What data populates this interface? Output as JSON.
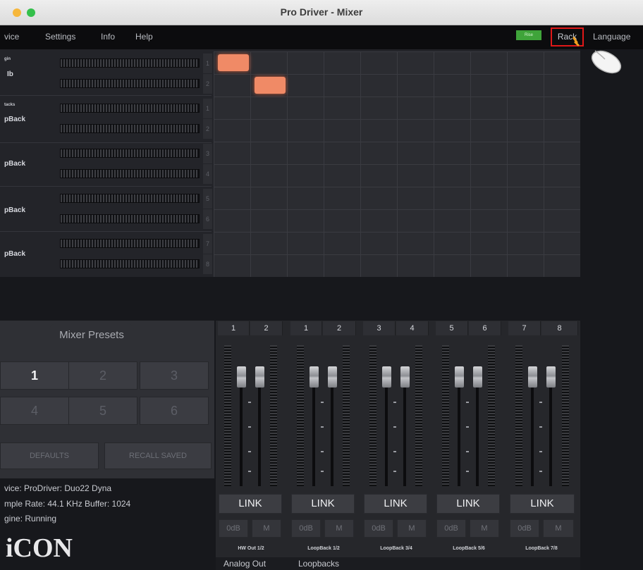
{
  "window": {
    "title": "Pro Driver - Mixer"
  },
  "menu": {
    "items": [
      "vice",
      "Settings",
      "Info",
      "Help"
    ],
    "rise_label": "Rise",
    "rack_label": "Rack",
    "language_label": "Language"
  },
  "routing": {
    "source_labels": {
      "g1_small": "gin",
      "g1_main": "Ib",
      "g2_small": "tacks",
      "g2_main": "pBack",
      "g3_main": "pBack",
      "g4_main": "pBack",
      "g5_main": "pBack"
    },
    "channel_numbers": [
      "1",
      "2",
      "1",
      "2",
      "3",
      "4",
      "5",
      "6",
      "7",
      "8"
    ]
  },
  "presets": {
    "title": "Mixer Presets",
    "buttons": [
      "1",
      "2",
      "3",
      "4",
      "5",
      "6"
    ],
    "active": "1",
    "defaults_label": "DEFAULTS",
    "recall_label": "RECALL SAVED"
  },
  "info": {
    "line1": "vice: ProDriver: Duo22 Dyna",
    "line2": "mple Rate: 44.1 KHz Buffer: 1024",
    "line3": "gine: Running",
    "logo": "iCON"
  },
  "mixer": {
    "channel_heads": [
      "1",
      "2",
      "1",
      "2",
      "3",
      "4",
      "5",
      "6",
      "7",
      "8"
    ],
    "link_label": "LINK",
    "out_label": "0dB",
    "mute_label": "M",
    "strip_labels": [
      "HW Out 1/2",
      "LoopBack 1/2",
      "LoopBack 3/4",
      "LoopBack 5/6",
      "LoopBack 7/8"
    ]
  },
  "tabs": [
    "Analog Out",
    "Loopbacks"
  ]
}
